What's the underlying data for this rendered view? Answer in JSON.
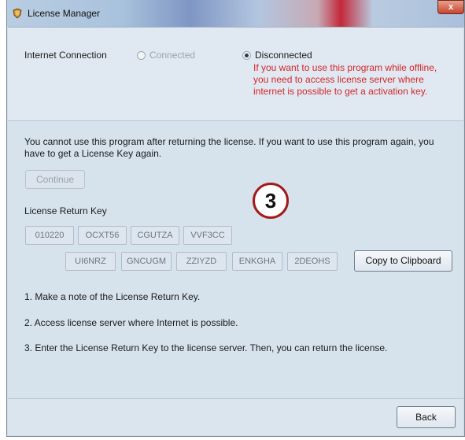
{
  "window": {
    "title": "License Manager",
    "close_label": "x",
    "accent_color": "#c4283a"
  },
  "connection": {
    "label": "Internet Connection",
    "connected_label": "Connected",
    "disconnected_label": "Disconnected",
    "selected": "Disconnected",
    "warning": "If you want to use this program while offline, you need to access license server where internet is possible to get a activation key.",
    "warning_color": "#d3262c"
  },
  "main": {
    "info_text": "You cannot use this program after returning the license. If you want to use this program again, you have to get a License Key again.",
    "continue_label": "Continue",
    "return_key_label": "License Return Key",
    "keys_row1": [
      "010220",
      "OCXT56",
      "CGUTZA",
      "VVF3CC"
    ],
    "keys_row2": [
      "UI6NRZ",
      "GNCUGM",
      "ZZIYZD",
      "ENKGHA",
      "2DEOHS"
    ],
    "copy_label": "Copy to Clipboard",
    "steps": [
      "1. Make a note of the License Return Key.",
      "2. Access license server where Internet is possible.",
      "3. Enter the License Return Key to the license server. Then, you can return the license."
    ]
  },
  "annotation": {
    "step_number": "3"
  },
  "footer": {
    "back_label": "Back"
  }
}
